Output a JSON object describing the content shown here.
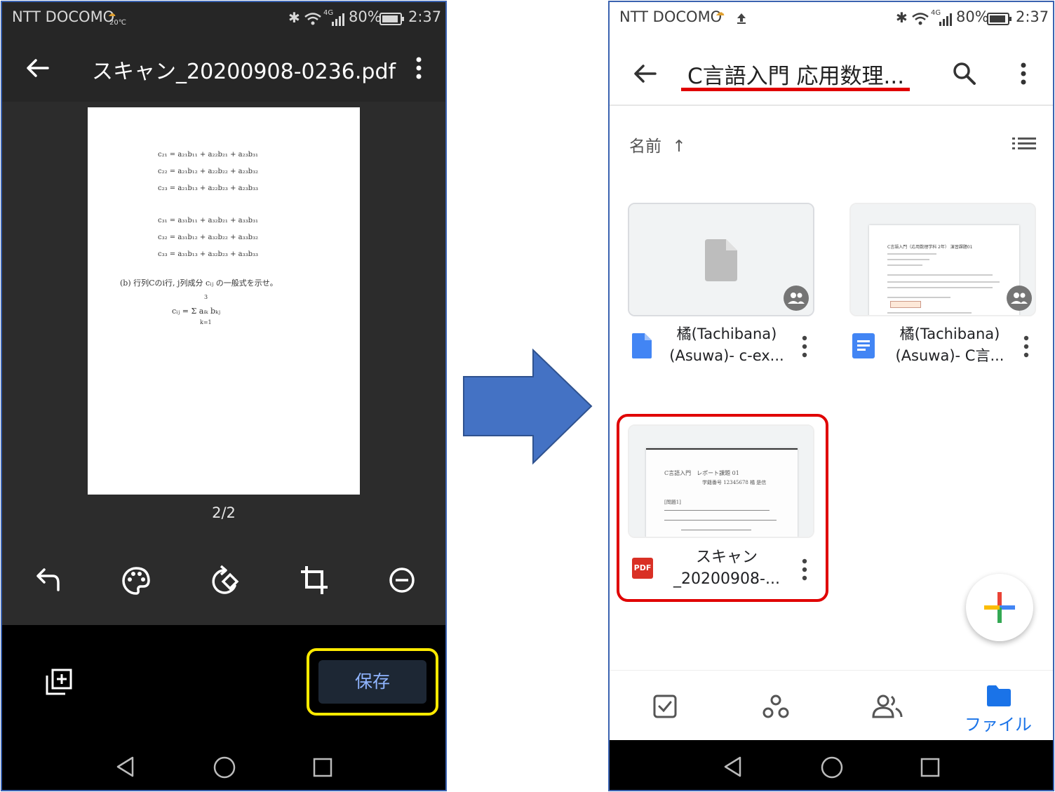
{
  "left_phone": {
    "status": {
      "carrier": "NTT DOCOMO",
      "weather_sub": "20℃",
      "network": "4G",
      "battery": "80%",
      "time": "2:37"
    },
    "appbar": {
      "title": "スキャン_20200908-0236.pdf"
    },
    "scan_page": {
      "lines_group1": [
        "c₂₁ = a₂₁b₁₁ + a₂₂b₂₁ + a₂₃b₃₁",
        "c₂₂ = a₂₁b₁₂ + a₂₂b₂₂ + a₂₃b₃₂",
        "c₂₃ = a₂₁b₁₃ + a₂₂b₂₃ + a₂₃b₃₃"
      ],
      "lines_group2": [
        "c₃₁ = a₃₁b₁₁ + a₃₂b₂₁ + a₃₃b₃₁",
        "c₃₂ = a₃₁b₁₂ + a₃₂b₂₂ + a₃₃b₃₂",
        "c₃₃ = a₃₁b₁₃ + a₃₂b₂₃ + a₃₃b₃₃"
      ],
      "question": "(b) 行列Cのi行, j列成分 cᵢⱼ の一般式を示せ。",
      "formula": "cᵢⱼ = Σ aᵢₖ bₖⱼ",
      "sum_top": "3",
      "sum_bottom": "k=1"
    },
    "page_indicator": "2/2",
    "save_label": "保存"
  },
  "right_phone": {
    "status": {
      "carrier": "NTT DOCOMO",
      "network": "4G",
      "battery": "80%",
      "time": "2:37"
    },
    "appbar": {
      "title": "C言語入門 応用数理..."
    },
    "sort": {
      "label": "名前",
      "arrow": "↑"
    },
    "files": [
      {
        "name_line1": "橘(Tachibana)",
        "name_line2": "(Asuwa)- c-ex...",
        "type": "file"
      },
      {
        "name_line1": "橘(Tachibana)",
        "name_line2": "(Asuwa)- C言...",
        "type": "doc",
        "thumb_title": "C言語入門（応用数理学科 2年） 演習課題01"
      },
      {
        "name_line1": "スキャン",
        "name_line2": "_20200908-...",
        "type": "pdf",
        "pdf_badge": "PDF",
        "thumb_line1": "C言語入門　レポート課題 01",
        "thumb_line2": "学籍番号 12345678  橘 是信",
        "thumb_line3": "[問題1]"
      }
    ],
    "bottom_nav": {
      "files_label": "ファイル"
    }
  },
  "colors": {
    "save_highlight": "#ffea00",
    "red_highlight": "#e00000",
    "accent_blue": "#1a73e8",
    "arrow_blue": "#4472c4"
  }
}
